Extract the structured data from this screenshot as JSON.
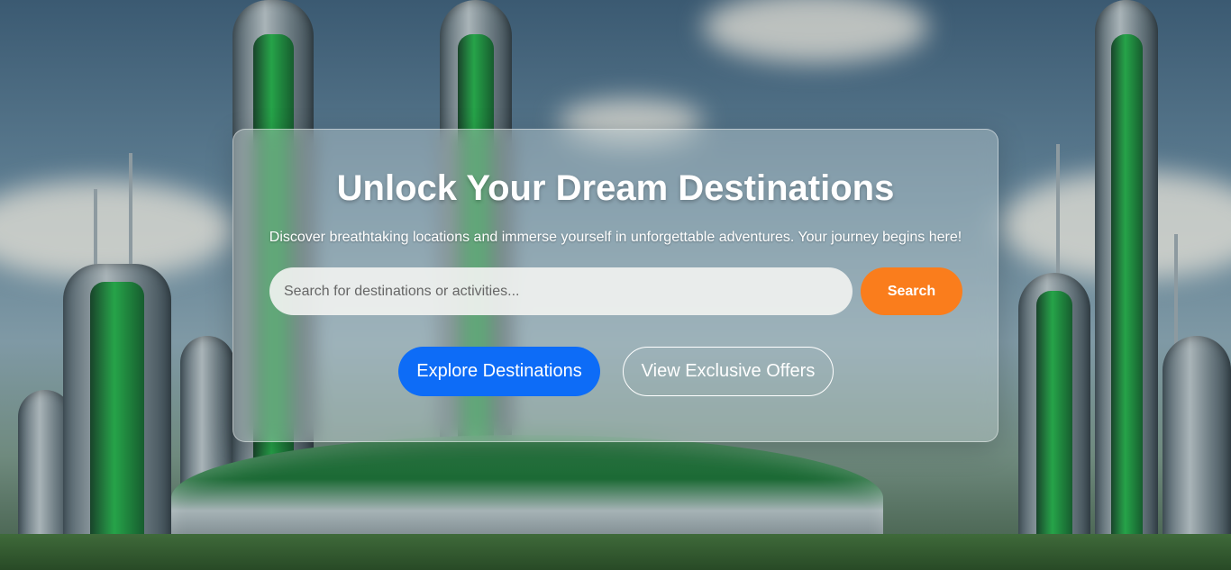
{
  "hero": {
    "background_image": "futuristic-green-city-skyline",
    "title": "Unlock Your Dream Destinations",
    "subtitle": "Discover breathtaking locations and immerse yourself in unforgettable adventures. Your journey begins here!"
  },
  "search": {
    "placeholder": "Search for destinations or activities...",
    "value": "",
    "button_label": "Search"
  },
  "actions": {
    "explore_label": "Explore Destinations",
    "offers_label": "View Exclusive Offers"
  },
  "colors": {
    "search_button": "#fa7d1c",
    "explore_button": "#0d6cf7",
    "text": "#ffffff"
  }
}
